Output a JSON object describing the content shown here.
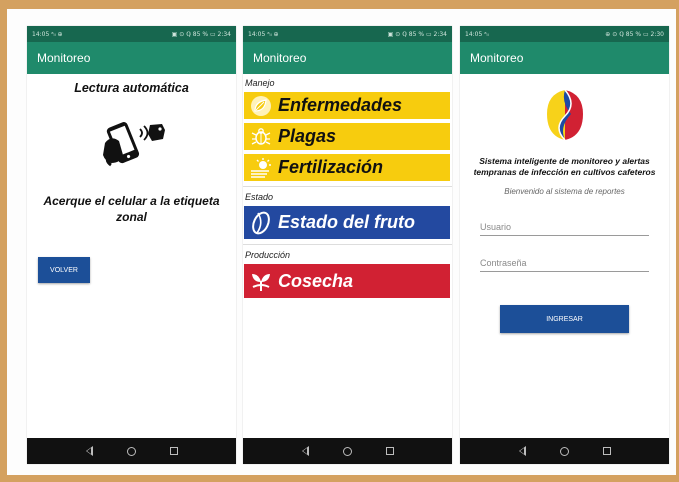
{
  "status_bar": {
    "p1_left": "14:05 ᵃᵢₗ ⊕",
    "p1_right": "▣ ⊙ ℚ 85 % ▭ 2:34",
    "p2_left": "14:05 ᵃᵢₗ ⊕",
    "p2_right": "▣ ⊙ ℚ 85 % ▭ 2:34",
    "p3_left": "14:05 ᵃᵢₗ",
    "p3_right": "⊕ ⊙ ℚ 85 % ▭ 2:30"
  },
  "app_title": "Monitoreo",
  "screen1": {
    "title": "Lectura automática",
    "nfc_icon": "nfc-phone-icon",
    "message": "Acerque el celular a la etiqueta zonal",
    "back_button": "VOLVER"
  },
  "screen2": {
    "sections": [
      {
        "label": "Manejo",
        "items": [
          {
            "label": "Enfermedades",
            "icon": "leaf-icon",
            "color": "#f7cc0e"
          },
          {
            "label": "Plagas",
            "icon": "bug-icon",
            "color": "#f7cc0e"
          },
          {
            "label": "Fertilización",
            "icon": "sun-fertilizer-icon",
            "color": "#f7cc0e"
          }
        ]
      },
      {
        "label": "Estado",
        "items": [
          {
            "label": "Estado del fruto",
            "icon": "coffee-bean-icon",
            "color": "#2349a0"
          }
        ]
      },
      {
        "label": "Producción",
        "items": [
          {
            "label": "Cosecha",
            "icon": "harvest-icon",
            "color": "#d12133"
          }
        ]
      }
    ]
  },
  "screen3": {
    "logo": "colombia-coffee-logo",
    "title": "Sistema inteligente de monitoreo y alertas tempranas de infección en cultivos cafeteros",
    "subtitle": "Bienvenido al sistema de reportes",
    "username_placeholder": "Usuario",
    "password_placeholder": "Contraseña",
    "login_button": "INGRESAR"
  },
  "colors": {
    "appbar": "#1f8a6b",
    "statusbar": "#17674f",
    "button_blue": "#1c4f98",
    "frame": "#d4a160"
  }
}
